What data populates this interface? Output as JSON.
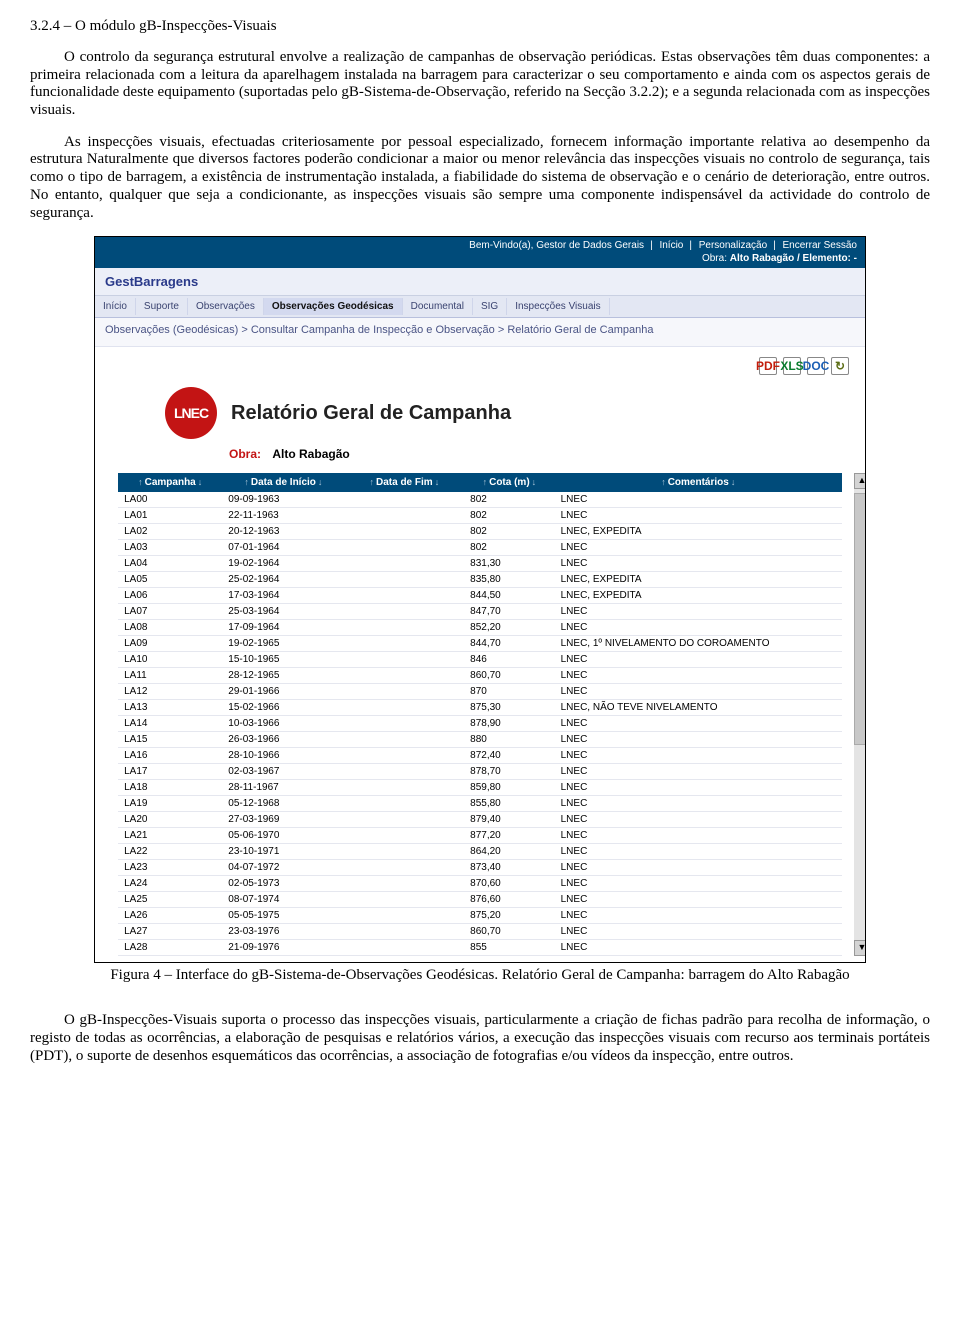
{
  "section": {
    "heading": "3.2.4 – O módulo gB-Inspecções-Visuais",
    "p1": "O controlo da segurança estrutural envolve a realização de campanhas de observação periódicas. Estas observações têm duas componentes: a primeira relacionada com a leitura da aparelhagem instalada na barragem para caracterizar o seu comportamento e ainda com os aspectos gerais de funcionalidade deste equipamento (suportadas pelo gB-Sistema-de-Observação, referido na Secção 3.2.2); e a segunda relacionada com as inspecções visuais.",
    "p2": "As inspecções visuais, efectuadas criteriosamente por pessoal especializado, fornecem informação importante relativa ao desempenho da estrutura Naturalmente que diversos factores poderão condicionar a maior ou menor relevância das inspecções visuais no controlo de segurança, tais como o tipo de barragem, a existência de instrumentação instalada, a fiabilidade do sistema de observação e o cenário de deterioração, entre outros. No entanto, qualquer que seja a condicionante, as inspecções visuais são sempre uma componente indispensável da actividade do controlo de segurança."
  },
  "app": {
    "welcome": "Bem-Vindo(a), Gestor de Dados Gerais",
    "links": {
      "inicio": "Início",
      "personalizacao": "Personalização",
      "encerrar": "Encerrar Sessão"
    },
    "obra_label": "Obra:",
    "obra_value": "Alto Rabagão / Elemento: -",
    "brand": "GestBarragens",
    "menu": [
      "Início",
      "Suporte",
      "Observações",
      "Observações Geodésicas",
      "Documental",
      "SIG",
      "Inspecções Visuais"
    ],
    "menu_selected_index": 3,
    "breadcrumb": "Observações (Geodésicas) > Consultar Campanha de Inspecção e Observação > Relatório Geral de Campanha",
    "toolbar": {
      "pdf": "PDF",
      "xls": "XLS",
      "doc": "DOC",
      "refresh": "↻"
    },
    "report": {
      "logo_text": "LNEC",
      "title": "Relatório Geral de Campanha",
      "obra_key": "Obra:",
      "obra_val": "Alto Rabagão"
    }
  },
  "table": {
    "headers": {
      "campanha": "Campanha",
      "inicio": "Data de Início",
      "fim": "Data de Fim",
      "cota": "Cota (m)",
      "comentarios": "Comentários"
    },
    "rows": [
      {
        "c": "LA00",
        "i": "09-09-1963",
        "f": "",
        "cota": "802",
        "cm": "LNEC"
      },
      {
        "c": "LA01",
        "i": "22-11-1963",
        "f": "",
        "cota": "802",
        "cm": "LNEC"
      },
      {
        "c": "LA02",
        "i": "20-12-1963",
        "f": "",
        "cota": "802",
        "cm": "LNEC, EXPEDITA"
      },
      {
        "c": "LA03",
        "i": "07-01-1964",
        "f": "",
        "cota": "802",
        "cm": "LNEC"
      },
      {
        "c": "LA04",
        "i": "19-02-1964",
        "f": "",
        "cota": "831,30",
        "cm": "LNEC"
      },
      {
        "c": "LA05",
        "i": "25-02-1964",
        "f": "",
        "cota": "835,80",
        "cm": "LNEC, EXPEDITA"
      },
      {
        "c": "LA06",
        "i": "17-03-1964",
        "f": "",
        "cota": "844,50",
        "cm": "LNEC, EXPEDITA"
      },
      {
        "c": "LA07",
        "i": "25-03-1964",
        "f": "",
        "cota": "847,70",
        "cm": "LNEC"
      },
      {
        "c": "LA08",
        "i": "17-09-1964",
        "f": "",
        "cota": "852,20",
        "cm": "LNEC"
      },
      {
        "c": "LA09",
        "i": "19-02-1965",
        "f": "",
        "cota": "844,70",
        "cm": "LNEC, 1º NIVELAMENTO DO COROAMENTO"
      },
      {
        "c": "LA10",
        "i": "15-10-1965",
        "f": "",
        "cota": "846",
        "cm": "LNEC"
      },
      {
        "c": "LA11",
        "i": "28-12-1965",
        "f": "",
        "cota": "860,70",
        "cm": "LNEC"
      },
      {
        "c": "LA12",
        "i": "29-01-1966",
        "f": "",
        "cota": "870",
        "cm": "LNEC"
      },
      {
        "c": "LA13",
        "i": "15-02-1966",
        "f": "",
        "cota": "875,30",
        "cm": "LNEC, NÃO TEVE NIVELAMENTO"
      },
      {
        "c": "LA14",
        "i": "10-03-1966",
        "f": "",
        "cota": "878,90",
        "cm": "LNEC"
      },
      {
        "c": "LA15",
        "i": "26-03-1966",
        "f": "",
        "cota": "880",
        "cm": "LNEC"
      },
      {
        "c": "LA16",
        "i": "28-10-1966",
        "f": "",
        "cota": "872,40",
        "cm": "LNEC"
      },
      {
        "c": "LA17",
        "i": "02-03-1967",
        "f": "",
        "cota": "878,70",
        "cm": "LNEC"
      },
      {
        "c": "LA18",
        "i": "28-11-1967",
        "f": "",
        "cota": "859,80",
        "cm": "LNEC"
      },
      {
        "c": "LA19",
        "i": "05-12-1968",
        "f": "",
        "cota": "855,80",
        "cm": "LNEC"
      },
      {
        "c": "LA20",
        "i": "27-03-1969",
        "f": "",
        "cota": "879,40",
        "cm": "LNEC"
      },
      {
        "c": "LA21",
        "i": "05-06-1970",
        "f": "",
        "cota": "877,20",
        "cm": "LNEC"
      },
      {
        "c": "LA22",
        "i": "23-10-1971",
        "f": "",
        "cota": "864,20",
        "cm": "LNEC"
      },
      {
        "c": "LA23",
        "i": "04-07-1972",
        "f": "",
        "cota": "873,40",
        "cm": "LNEC"
      },
      {
        "c": "LA24",
        "i": "02-05-1973",
        "f": "",
        "cota": "870,60",
        "cm": "LNEC"
      },
      {
        "c": "LA25",
        "i": "08-07-1974",
        "f": "",
        "cota": "876,60",
        "cm": "LNEC"
      },
      {
        "c": "LA26",
        "i": "05-05-1975",
        "f": "",
        "cota": "875,20",
        "cm": "LNEC"
      },
      {
        "c": "LA27",
        "i": "23-03-1976",
        "f": "",
        "cota": "860,70",
        "cm": "LNEC"
      },
      {
        "c": "LA28",
        "i": "21-09-1976",
        "f": "",
        "cota": "855",
        "cm": "LNEC"
      }
    ]
  },
  "figure": {
    "caption": "Figura 4 – Interface do gB-Sistema-de-Observações Geodésicas. Relatório Geral de Campanha: barragem do Alto Rabagão"
  },
  "closing": {
    "p3": "O gB-Inspecções-Visuais suporta o processo das inspecções visuais, particularmente a criação de fichas padrão para recolha de informação, o registo de todas as ocorrências, a elaboração de pesquisas e relatórios vários, a execução das inspecções visuais com recurso aos terminais portáteis (PDT), o suporte de desenhos esquemáticos das ocorrências, a associação de fotografias e/ou vídeos da inspecção, entre outros."
  }
}
